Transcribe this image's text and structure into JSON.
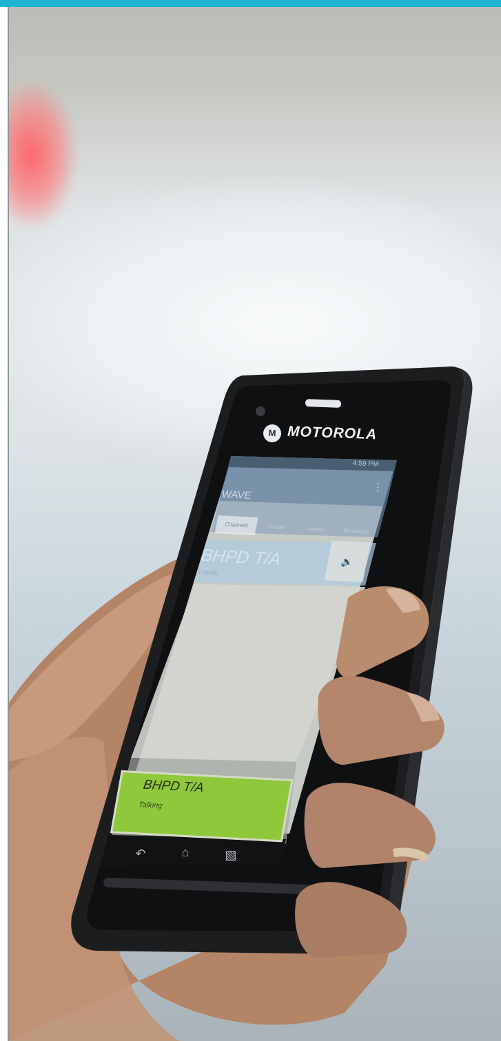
{
  "phone": {
    "brand": "MOTOROLA",
    "logo_glyph": "M",
    "status_time": "4:59 PM",
    "app_title": "WAVE",
    "menu_glyph": "⋮",
    "tabs": [
      "Channels",
      "People",
      "History",
      "Messages"
    ],
    "active_tab_index": 0,
    "channel": {
      "name": "BHPD T/A",
      "subtitle": "Fitstalk"
    },
    "speaker_icon": "speaker-volume-icon",
    "ptt": {
      "name": "BHPD T/A",
      "status": "Talking"
    },
    "nav": {
      "back_icon": "back-arrow-icon",
      "home_icon": "home-icon",
      "recent_icon": "recent-apps-icon"
    }
  },
  "colors": {
    "top_bar": "#1fb3d1",
    "ptt_green": "#8fc83b",
    "phone_body": "#1c1d1f"
  }
}
